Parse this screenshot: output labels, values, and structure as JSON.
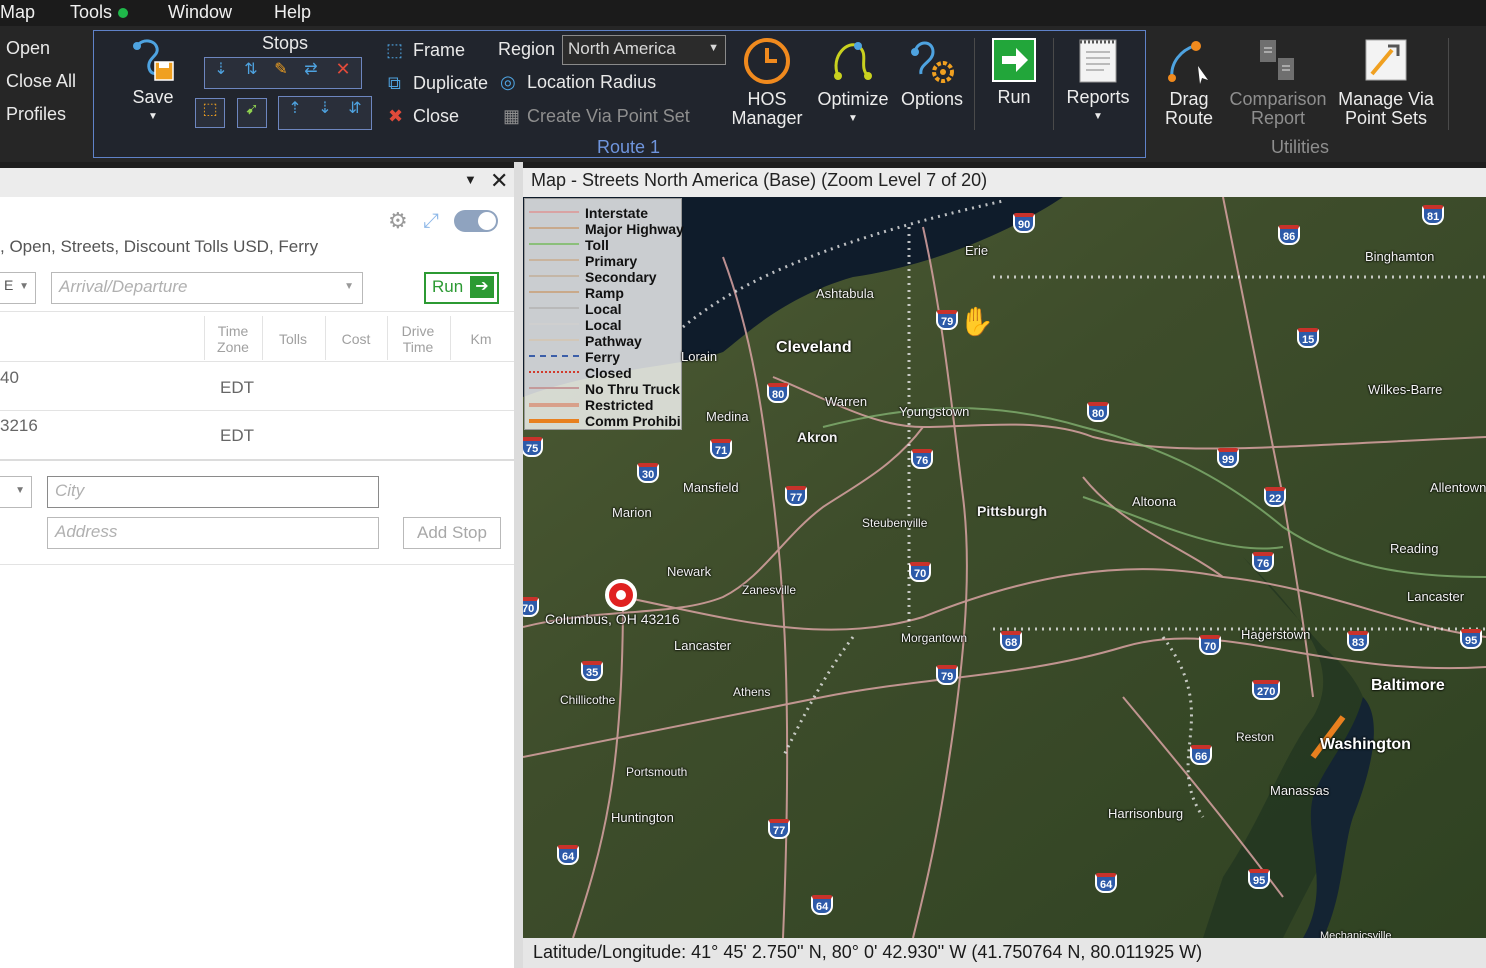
{
  "menubar": {
    "items": [
      "Map",
      "Tools",
      "Window",
      "Help"
    ]
  },
  "ribbon": {
    "file_items": [
      "Open",
      "Close All",
      "Profiles"
    ],
    "save_label": "Save",
    "stops_label": "Stops",
    "frame_label": "Frame",
    "duplicate_label": "Duplicate",
    "close_label": "Close",
    "region_label": "Region",
    "region_value": "North America",
    "location_radius_label": "Location Radius",
    "create_via_label": "Create Via Point Set",
    "route_group_label": "Route 1",
    "hos_label": [
      "HOS",
      "Manager"
    ],
    "optimize_label": "Optimize",
    "options_label": "Options",
    "run_label": "Run",
    "reports_label": "Reports",
    "drag_route_label": [
      "Drag",
      "Route"
    ],
    "comparison_label": [
      "Comparison",
      "Report"
    ],
    "manage_via_label": [
      "Manage Via",
      "Point Sets"
    ],
    "utilities_label": "Utilities"
  },
  "left_panel": {
    "options_text": ", Open, Streets, Discount Tolls USD, Ferry",
    "select1_value": "E",
    "arrival_placeholder": "Arrival/Departure",
    "run_button": "Run",
    "columns": [
      [
        "Time",
        "Zone"
      ],
      [
        "Tolls"
      ],
      [
        "Cost"
      ],
      [
        "Drive",
        "Time"
      ],
      [
        "Km"
      ]
    ],
    "rows": [
      {
        "stop": "40",
        "zone": "EDT"
      },
      {
        "stop": "3216",
        "zone": "EDT"
      }
    ],
    "city_placeholder": "City",
    "address_placeholder": "Address",
    "add_stop": "Add Stop"
  },
  "map": {
    "title": "Map - Streets North America (Base) (Zoom Level 7 of 20)",
    "legend": [
      "Interstate",
      "Major Highway",
      "Toll",
      "Primary",
      "Secondary",
      "Ramp",
      "Local",
      "Local",
      "Pathway",
      "Ferry",
      "Closed",
      "No Thru Truck",
      "Restricted",
      "Comm Prohibi"
    ],
    "legend_colors": [
      "#d9a3a3",
      "#c8a98c",
      "#8bbf7a",
      "#c9b49e",
      "#c4b6a6",
      "#c9a98a",
      "#b9b9b9",
      "#cfcfcf",
      "#d2c7b8",
      "#3b5ea8",
      "#d13b2d",
      "#c49a9a",
      "#d8a08a",
      "#e8801f"
    ],
    "cities": [
      "Erie",
      "Binghamton",
      "Ashtabula",
      "Cleveland",
      "Lorain",
      "Medina",
      "Warren",
      "Youngstown",
      "Akron",
      "Wilkes-Barre",
      "Mansfield",
      "Altoona",
      "Allentown",
      "Marion",
      "Steubenville",
      "Pittsburgh",
      "Reading",
      "Newark",
      "Zanesville",
      "Lancaster",
      "Columbus, OH 43216",
      "Morgantown",
      "Hagerstown",
      "Baltimore",
      "Lancaster",
      "Chillicothe",
      "Athens",
      "Reston",
      "Washington",
      "Manassas",
      "Portsmouth",
      "Huntington",
      "Harrisonburg",
      "Mechanicsville"
    ],
    "shields": [
      "90",
      "86",
      "81",
      "79",
      "80",
      "80",
      "80",
      "71",
      "76",
      "99",
      "30",
      "77",
      "22",
      "15",
      "70",
      "76",
      "70",
      "68",
      "70",
      "83",
      "95",
      "79",
      "270",
      "35",
      "66",
      "77",
      "64",
      "64",
      "95",
      "64",
      "75",
      "70"
    ],
    "status": "Latitude/Longitude: 41° 45' 2.750'' N,  80°  0' 42.930'' W (41.750764 N, 80.011925 W)"
  }
}
